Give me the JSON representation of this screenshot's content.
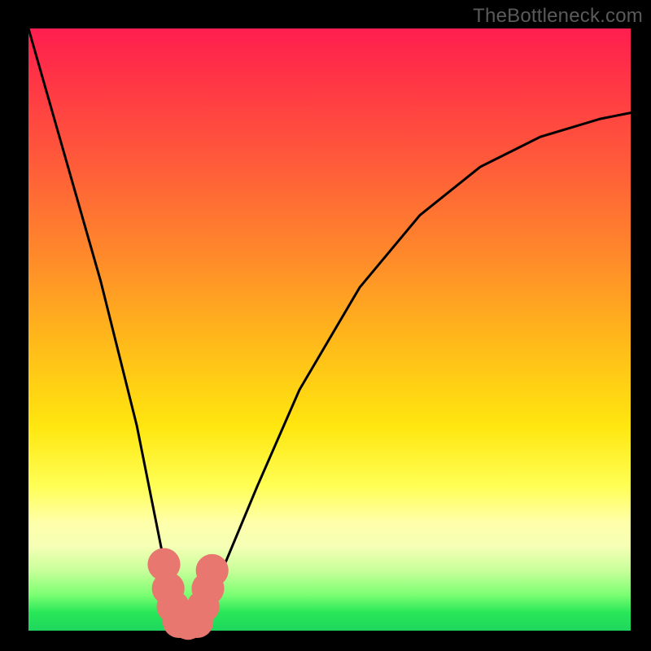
{
  "watermark": "TheBottleneck.com",
  "chart_data": {
    "type": "line",
    "title": "",
    "xlabel": "",
    "ylabel": "",
    "xlim": [
      0,
      100
    ],
    "ylim": [
      0,
      100
    ],
    "grid": false,
    "series": [
      {
        "name": "bottleneck-curve",
        "color": "#000000",
        "x": [
          0,
          4,
          8,
          12,
          15,
          18,
          20,
          22,
          23.5,
          25,
          26,
          27,
          28.5,
          30,
          33,
          38,
          45,
          55,
          65,
          75,
          85,
          95,
          100
        ],
        "y": [
          100,
          86,
          72,
          58,
          46,
          34,
          24,
          14,
          7,
          2,
          1,
          1,
          2,
          5,
          12,
          24,
          40,
          57,
          69,
          77,
          82,
          85,
          86
        ]
      }
    ],
    "markers": [
      {
        "name": "left-dot-1",
        "x": 22.5,
        "y": 11,
        "r": 1.7,
        "color": "#e8786f"
      },
      {
        "name": "left-dot-2",
        "x": 23.2,
        "y": 7,
        "r": 1.7,
        "color": "#e8786f"
      },
      {
        "name": "left-dot-3",
        "x": 24.0,
        "y": 4,
        "r": 1.7,
        "color": "#e8786f"
      },
      {
        "name": "floor-dot-1",
        "x": 25.0,
        "y": 1.5,
        "r": 1.7,
        "color": "#e8786f"
      },
      {
        "name": "floor-dot-2",
        "x": 26.5,
        "y": 1.2,
        "r": 1.7,
        "color": "#e8786f"
      },
      {
        "name": "floor-dot-3",
        "x": 28.0,
        "y": 1.5,
        "r": 1.7,
        "color": "#e8786f"
      },
      {
        "name": "right-dot-1",
        "x": 29.0,
        "y": 4,
        "r": 1.7,
        "color": "#e8786f"
      },
      {
        "name": "right-dot-2",
        "x": 29.8,
        "y": 7,
        "r": 1.7,
        "color": "#e8786f"
      },
      {
        "name": "right-dot-3",
        "x": 30.5,
        "y": 10,
        "r": 1.7,
        "color": "#e8786f"
      }
    ]
  }
}
